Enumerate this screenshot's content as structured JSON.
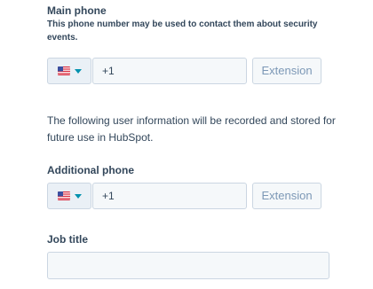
{
  "main_phone": {
    "label": "Main phone",
    "help": "This phone number may be used to contact them about security events.",
    "country_icon": "us-flag-icon",
    "value": "+1",
    "extension_placeholder": "Extension"
  },
  "info_text": "The following user information will be recorded and stored for future use in HubSpot.",
  "additional_phone": {
    "label": "Additional phone",
    "country_icon": "us-flag-icon",
    "value": "+1",
    "extension_placeholder": "Extension"
  },
  "job_title": {
    "label": "Job title",
    "value": ""
  },
  "colors": {
    "text": "#33475b",
    "input_border": "#cbd6e2",
    "input_bg": "#f5f8fa",
    "caret_accent": "#0091ae",
    "placeholder": "#7c98b6"
  }
}
